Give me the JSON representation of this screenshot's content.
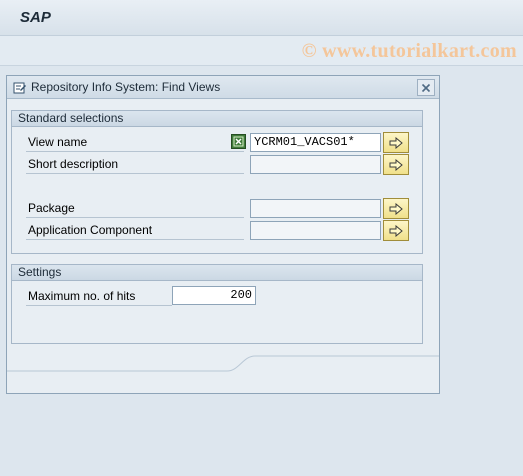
{
  "app": {
    "title": "SAP"
  },
  "watermark": "© www.tutorialkart.com",
  "dialog": {
    "title": "Repository Info System: Find Views",
    "standard_selections": {
      "header": "Standard selections",
      "fields": [
        {
          "label": "View name",
          "value": "YCRM01_VACS01*"
        },
        {
          "label": "Short description",
          "value": ""
        },
        {
          "label": "Package",
          "value": ""
        },
        {
          "label": "Application Component",
          "value": ""
        }
      ]
    },
    "settings": {
      "header": "Settings",
      "max_hits_label": "Maximum no. of hits",
      "max_hits_value": "200"
    }
  },
  "icons": {
    "dialog": "dialog-edit-icon",
    "close": "close-icon",
    "multiple_selection": "multiple-selection-arrow-icon",
    "selection_option": "selection-option-icon"
  },
  "colors": {
    "background": "#dde6ee",
    "dialog_bg": "#e8eef3",
    "button_yellow": "#f0e08a",
    "watermark": "#f4c69a",
    "selection_green": "#3f7a3a"
  }
}
